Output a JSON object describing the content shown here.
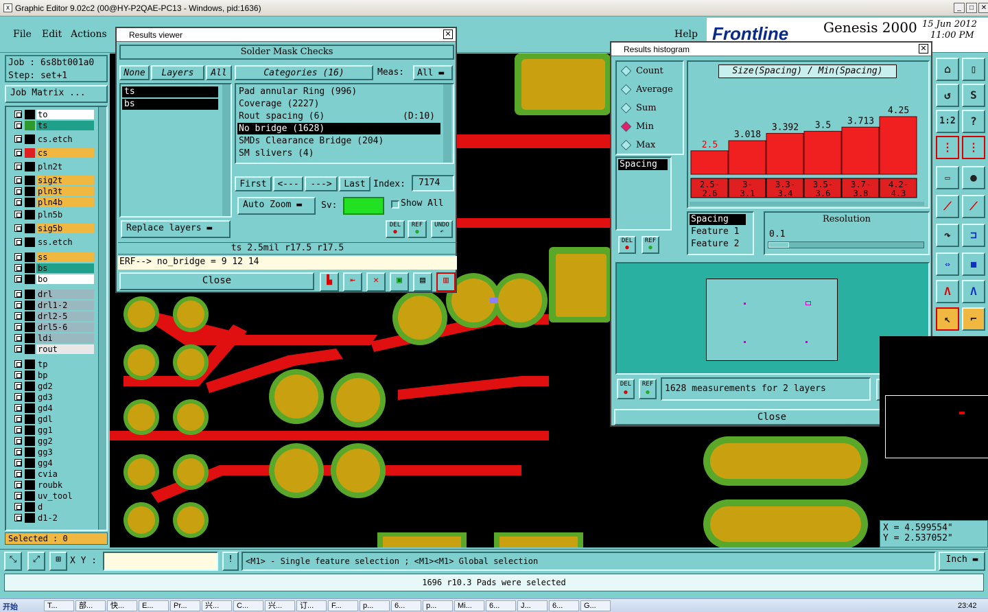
{
  "window": {
    "title": "Graphic Editor 9.02c2 (00@HY-P2QAE-PC13 - Windows, pid:1636)"
  },
  "menu": {
    "file": "File",
    "edit": "Edit",
    "actions": "Actions",
    "help": "Help"
  },
  "brand": {
    "logo": "Frontline",
    "product": "Genesis 2000",
    "date": "15 Jun 2012",
    "time": "11:00 PM"
  },
  "job": {
    "job_label": "Job : 6s8bt001a0",
    "step_label": "Step: set+1",
    "matrix_button": "Job Matrix ..."
  },
  "layers": [
    {
      "name": "to",
      "color": "#ffffff",
      "swatch": "#000000"
    },
    {
      "name": "ts",
      "color": "#1ea08a",
      "swatch": "#2e9a2e"
    },
    {
      "name": "cs.etch",
      "color": "#7fcfcf",
      "swatch": "#000000"
    },
    {
      "name": "cs",
      "color": "#f0b840",
      "swatch": "#e02020"
    },
    {
      "name": "pln2t",
      "color": "#7fcfcf",
      "swatch": "#000000"
    },
    {
      "name": "sig2t",
      "color": "#f0b840",
      "swatch": "#000000"
    },
    {
      "name": "pln3t",
      "color": "#f0b840",
      "swatch": "#000000"
    },
    {
      "name": "pln4b",
      "color": "#f0b840",
      "swatch": "#000000"
    },
    {
      "name": "pln5b",
      "color": "#7fcfcf",
      "swatch": "#000000"
    },
    {
      "name": "sig5b",
      "color": "#f0b840",
      "swatch": "#000000"
    },
    {
      "name": "ss.etch",
      "color": "#7fcfcf",
      "swatch": "#000000"
    },
    {
      "name": "ss",
      "color": "#f0b840",
      "swatch": "#000000"
    },
    {
      "name": "bs",
      "color": "#1ea08a",
      "swatch": "#000000"
    },
    {
      "name": "bo",
      "color": "#ffffff",
      "swatch": "#000000"
    },
    {
      "name": "drl",
      "color": "#9ab8c0",
      "swatch": "#000000"
    },
    {
      "name": "drl1-2",
      "color": "#9ab8c0",
      "swatch": "#000000"
    },
    {
      "name": "drl2-5",
      "color": "#9ab8c0",
      "swatch": "#000000"
    },
    {
      "name": "drl5-6",
      "color": "#9ab8c0",
      "swatch": "#000000"
    },
    {
      "name": "ldi",
      "color": "#9ab8c0",
      "swatch": "#000000"
    },
    {
      "name": "rout",
      "color": "#e8e8e8",
      "swatch": "#000000"
    },
    {
      "name": "tp",
      "color": "#7fcfcf",
      "swatch": "#000000"
    },
    {
      "name": "bp",
      "color": "#7fcfcf",
      "swatch": "#000000"
    },
    {
      "name": "gd2",
      "color": "#7fcfcf",
      "swatch": "#000000"
    },
    {
      "name": "gd3",
      "color": "#7fcfcf",
      "swatch": "#000000"
    },
    {
      "name": "gd4",
      "color": "#7fcfcf",
      "swatch": "#000000"
    },
    {
      "name": "gdl",
      "color": "#7fcfcf",
      "swatch": "#000000"
    },
    {
      "name": "gg1",
      "color": "#7fcfcf",
      "swatch": "#000000"
    },
    {
      "name": "gg2",
      "color": "#7fcfcf",
      "swatch": "#000000"
    },
    {
      "name": "gg3",
      "color": "#7fcfcf",
      "swatch": "#000000"
    },
    {
      "name": "gg4",
      "color": "#7fcfcf",
      "swatch": "#000000"
    },
    {
      "name": "cvia",
      "color": "#7fcfcf",
      "swatch": "#000000"
    },
    {
      "name": "roubk",
      "color": "#7fcfcf",
      "swatch": "#000000"
    },
    {
      "name": "uv_tool",
      "color": "#7fcfcf",
      "swatch": "#000000"
    },
    {
      "name": "d",
      "color": "#7fcfcf",
      "swatch": "#000000"
    },
    {
      "name": "d1-2",
      "color": "#7fcfcf",
      "swatch": "#000000"
    }
  ],
  "selected_label": "Selected : 0",
  "results_viewer": {
    "title": "Results viewer",
    "heading": "Solder Mask Checks",
    "none": "None",
    "layers_label": "Layers",
    "all": "All",
    "layer_list": [
      "ts",
      "bs"
    ],
    "categories_label": "Categories (16)",
    "meas_label": "Meas:",
    "meas_value": "All",
    "categories": [
      {
        "label": "Pad annular Ring (996)",
        "extra": ""
      },
      {
        "label": "Coverage (2227)",
        "extra": ""
      },
      {
        "label": "Rout spacing (6)",
        "extra": "(D:10)"
      },
      {
        "label": "No bridge (1628)",
        "extra": ""
      },
      {
        "label": "SMDs Clearance Bridge (204)",
        "extra": ""
      },
      {
        "label": "SM slivers (4)",
        "extra": ""
      }
    ],
    "first": "First",
    "prev": "<---",
    "next": "--->",
    "last": "Last",
    "index_label": "Index:",
    "index_value": "7174",
    "replace_layers": "Replace layers",
    "auto_zoom": "Auto Zoom",
    "sv_label": "Sv:",
    "show_all": "Show All",
    "del": "DEL",
    "ref": "REF",
    "undo": "UNDO",
    "info": "ts 2.5mil   r17.5   r17.5",
    "erf": "ERF--> no_bridge = 9 12 14",
    "close": "Close"
  },
  "histogram": {
    "title": "Results histogram",
    "modes": [
      {
        "label": "Count",
        "on": false
      },
      {
        "label": "Average",
        "on": false
      },
      {
        "label": "Sum",
        "on": false
      },
      {
        "label": "Min",
        "on": true
      },
      {
        "label": "Max",
        "on": false
      }
    ],
    "chart_title": "Size(Spacing) / Min(Spacing)",
    "mode_list": [
      "Spacing"
    ],
    "fields": [
      "Spacing",
      "Feature 1",
      "Feature 2"
    ],
    "resolution_label": "Resolution",
    "resolution_value": "0.1",
    "summary": "1628 measurements for 2 layers",
    "close": "Close",
    "del": "DEL",
    "ref": "REF"
  },
  "chart_data": {
    "type": "bar",
    "title": "Size(Spacing) / Min(Spacing)",
    "categories": [
      "2.5-2.6",
      "3-3.1",
      "3.3-3.4",
      "3.5-3.6",
      "3.7-3.8",
      "4.2-4.3"
    ],
    "values": [
      2.5,
      3.018,
      3.392,
      3.5,
      3.713,
      4.25
    ],
    "value_labels": [
      "2.5",
      "3.018",
      "3.392",
      "3.5",
      "3.713",
      "4.25"
    ],
    "bar_color": "#f02020",
    "highlight_color": "#e02020"
  },
  "coords": {
    "x": "X = 4.599554\"",
    "y": "Y = 2.537052\""
  },
  "statusbar": {
    "xy_label": "X Y :",
    "hint": "<M1> - Single feature selection ; <M1><M1> Global selection",
    "units": "Inch",
    "message": "1696 r10.3 Pads were selected"
  },
  "taskbar": {
    "start": "开始",
    "clock": "23:42",
    "items": [
      "T...",
      "部...",
      "快...",
      "E...",
      "Pr...",
      "兴...",
      "C...",
      "兴...",
      "订...",
      "F...",
      "p...",
      "6...",
      "p...",
      "Mi...",
      "6...",
      "J...",
      "6...",
      "G..."
    ]
  }
}
